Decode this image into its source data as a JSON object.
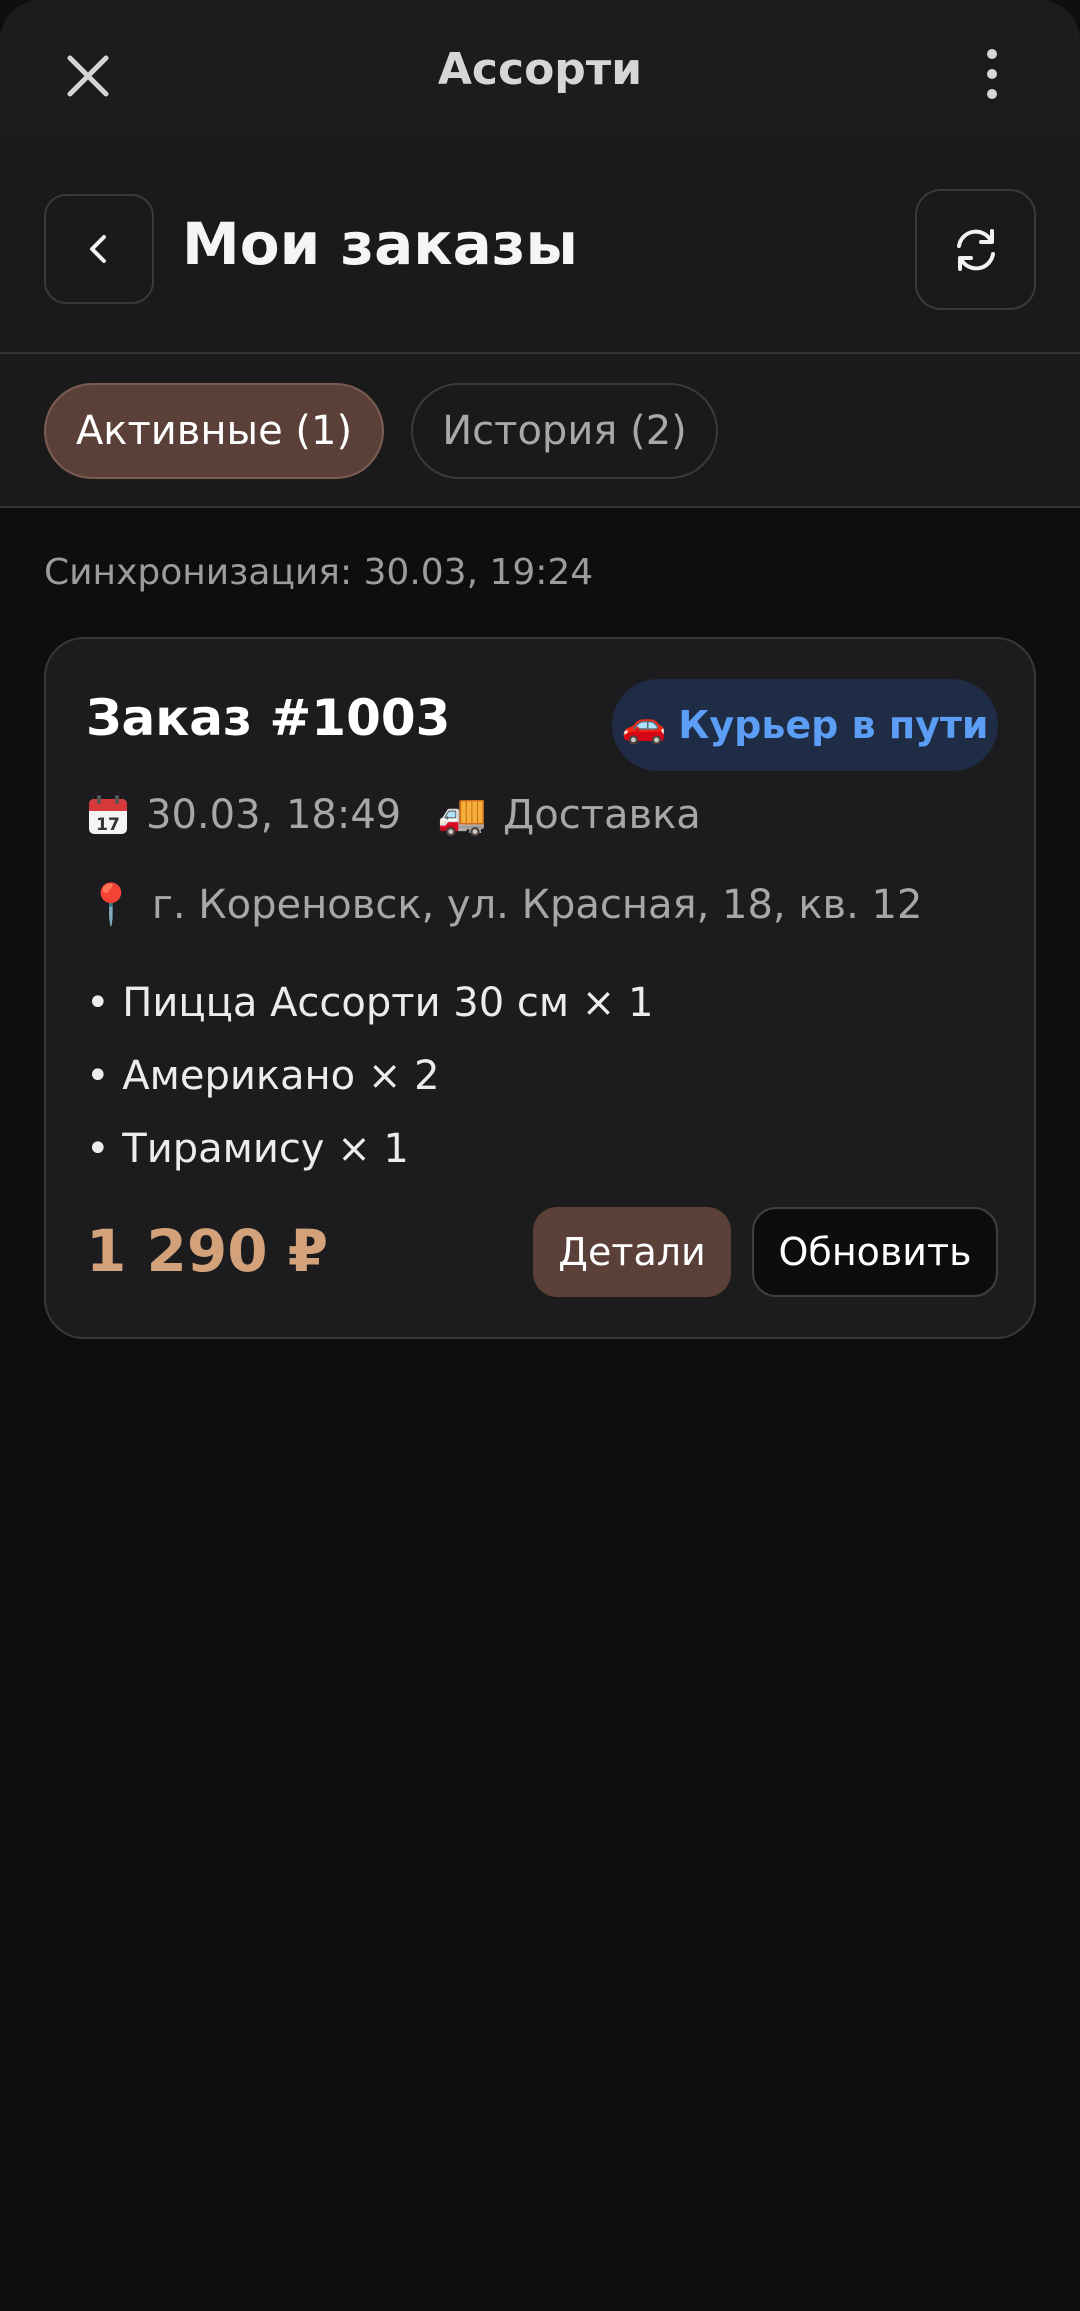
{
  "app": {
    "title": "Ассорти"
  },
  "header": {
    "title": "Мои заказы"
  },
  "tabs": [
    {
      "label": "Активные (1)",
      "active": true
    },
    {
      "label": "История (2)",
      "active": false
    }
  ],
  "sync_text": "Синхронизация: 30.03, 19:24",
  "order": {
    "title": "Заказ #1003",
    "status": "Курьер в пути",
    "status_icon": "🚗",
    "date": "30.03, 18:49",
    "date_icon": "calendar-icon",
    "delivery_type": "Доставка",
    "delivery_icon": "🚚",
    "address": "г. Кореновск, ул. Красная, 18, кв. 12",
    "address_icon": "📍",
    "items": [
      "• Пицца Ассорти 30 см × 1",
      "• Американо × 2",
      "• Тирамису × 1"
    ],
    "total": "1 290 ₽",
    "details_label": "Детали",
    "refresh_label": "Обновить"
  },
  "colors": {
    "accent": "#5a4038",
    "price": "#d4a27a",
    "status_text": "#5c9ef5",
    "status_bg": "#1f2c45",
    "background": "#0e0e0f"
  }
}
